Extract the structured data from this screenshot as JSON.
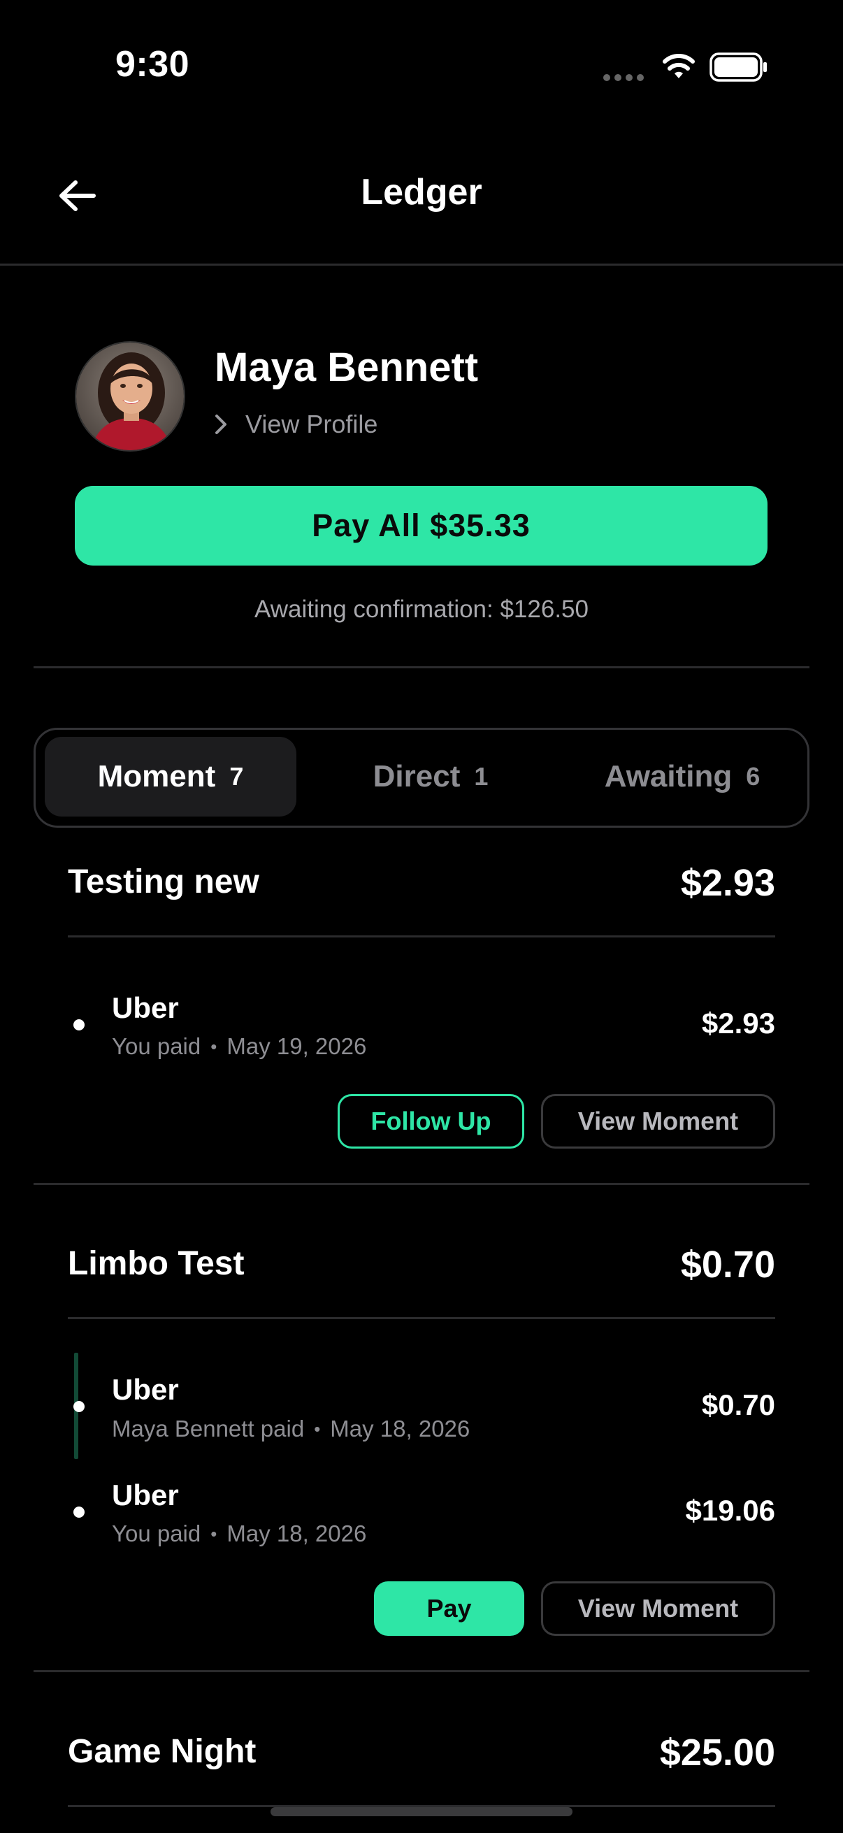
{
  "status_bar": {
    "time": "9:30"
  },
  "header": {
    "title": "Ledger"
  },
  "profile": {
    "name": "Maya Bennett",
    "view_profile_label": "View Profile",
    "pay_all_label": "Pay All $35.33",
    "awaiting_text": "Awaiting confirmation: $126.50"
  },
  "tabs": [
    {
      "label": "Moment",
      "count": "7",
      "active": true
    },
    {
      "label": "Direct",
      "count": "1",
      "active": false
    },
    {
      "label": "Awaiting",
      "count": "6",
      "active": false
    }
  ],
  "groups": [
    {
      "title": "Testing new",
      "amount": "$2.93",
      "items": [
        {
          "name": "Uber",
          "payer": "You paid",
          "date": "May 19, 2026",
          "amount": "$2.93"
        }
      ],
      "buttons": {
        "primary": "Follow Up",
        "secondary": "View Moment"
      }
    },
    {
      "title": "Limbo Test",
      "amount": "$0.70",
      "items": [
        {
          "name": "Uber",
          "payer": "Maya Bennett paid",
          "date": "May 18, 2026",
          "amount": "$0.70"
        },
        {
          "name": "Uber",
          "payer": "You paid",
          "date": "May 18, 2026",
          "amount": "$19.06"
        }
      ],
      "buttons": {
        "primary": "Pay",
        "secondary": "View Moment"
      }
    },
    {
      "title": "Game Night",
      "amount": "$25.00"
    }
  ],
  "colors": {
    "accent": "#2ee6a6",
    "background": "#000000",
    "muted": "#8e8e93"
  }
}
